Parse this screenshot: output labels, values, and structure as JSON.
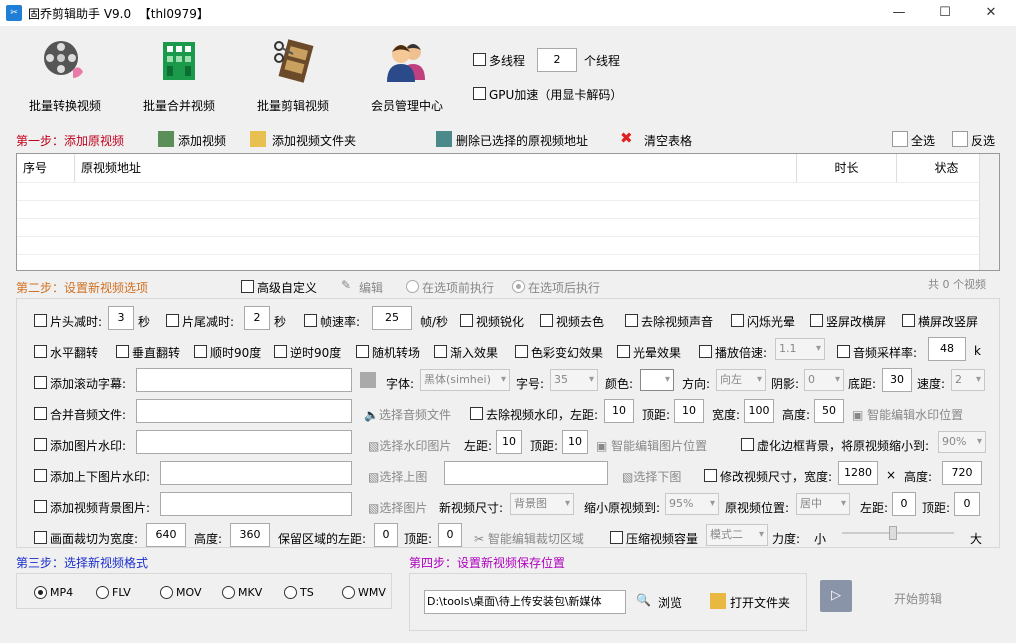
{
  "window": {
    "title": "固乔剪辑助手 V9.0  【thl0979】",
    "controls": {
      "minimize": "—",
      "maximize": "☐",
      "close": "✕"
    }
  },
  "toolbar": {
    "items": [
      {
        "label": "批量转换视频",
        "icon": "film-reel-icon"
      },
      {
        "label": "批量合并视频",
        "icon": "merge-film-icon"
      },
      {
        "label": "批量剪辑视频",
        "icon": "cut-film-icon"
      },
      {
        "label": "会员管理中心",
        "icon": "members-icon"
      }
    ],
    "multithread_label": "多线程",
    "thread_count": "2",
    "thread_unit": "个线程",
    "gpu_label": "GPU加速（用显卡解码）"
  },
  "step1": {
    "title": "第一步：添加原视频",
    "add_video": "添加视频",
    "add_folder": "添加视频文件夹",
    "remove_selected": "删除已选择的原视频地址",
    "clear_table": "清空表格",
    "select_all": "全选",
    "invert": "反选",
    "columns": [
      "序号",
      "原视频地址",
      "时长",
      "状态"
    ]
  },
  "step2": {
    "title": "第二步：设置新视频选项",
    "advanced": "高级自定义",
    "edit": "编辑",
    "before_option": "在选项前执行",
    "after_option": "在选项后执行",
    "count": "共 0 个视频",
    "row1": {
      "head_cut": "片头减时:",
      "head_val": "3",
      "sec1": "秒",
      "tail_cut": "片尾减时:",
      "tail_val": "2",
      "sec2": "秒",
      "framerate": "帧速率:",
      "framerate_val": "25",
      "fps": "帧/秒",
      "sharpen": "视频锐化",
      "decolor": "视频去色",
      "mute": "去除视频声音",
      "flash": "闪烁光晕",
      "v2h": "竖屏改横屏",
      "h2v": "横屏改竖屏"
    },
    "row2": {
      "hflip": "水平翻转",
      "vflip": "垂直翻转",
      "cw90": "顺时90度",
      "ccw90": "逆时90度",
      "random": "随机转场",
      "fadein": "渐入效果",
      "colorfx": "色彩变幻效果",
      "glow": "光晕效果",
      "speed": "播放倍速:",
      "speed_val": "1.1",
      "samplerate": "音频采样率:",
      "samplerate_val": "48",
      "k": "k"
    },
    "row3": {
      "subtitle": "添加滚动字幕:",
      "font": "字体:",
      "font_val": "黑体(simhei)",
      "size": "字号:",
      "size_val": "35",
      "color": "颜色:",
      "direction": "方向:",
      "direction_val": "向左",
      "shadow": "阴影:",
      "shadow_val": "0",
      "bottom": "底距:",
      "bottom_val": "30",
      "speed": "速度:",
      "speed_val": "2"
    },
    "row4": {
      "merge_audio": "合并音频文件:",
      "select_audio": "选择音频文件",
      "remove_watermark": "去除视频水印，左距:",
      "left_val": "10",
      "top": "顶距:",
      "top_val": "10",
      "width": "宽度:",
      "width_val": "100",
      "height": "高度:",
      "height_val": "50",
      "smart_wm": "智能编辑水印位置"
    },
    "row5": {
      "image_wm": "添加图片水印:",
      "select_wm": "选择水印图片",
      "left": "左距:",
      "left_val": "10",
      "top": "顶距:",
      "top_val": "10",
      "smart_img": "智能编辑图片位置",
      "blur_bg": "虚化边框背景，将原视频缩小到:",
      "blur_val": "90%"
    },
    "row6": {
      "topbottom": "添加上下图片水印:",
      "select_top": "选择上图",
      "select_bottom": "选择下图",
      "resize": "修改视频尺寸，宽度:",
      "width_val": "1280",
      "x": "×",
      "height": "高度:",
      "height_val": "720"
    },
    "row7": {
      "bg_image": "添加视频背景图片:",
      "select_img": "选择图片",
      "new_size": "新视频尺寸:",
      "new_size_val": "背景图",
      "shrink": "缩小原视频到:",
      "shrink_val": "95%",
      "position": "原视频位置:",
      "position_val": "居中",
      "left": "左距:",
      "left_val": "0",
      "top": "顶距:",
      "top_val": "0"
    },
    "row8": {
      "crop": "画面裁切为宽度:",
      "crop_w": "640",
      "height": "高度:",
      "crop_h": "360",
      "keep_left": "保留区域的左距:",
      "keep_left_val": "0",
      "top": "顶距:",
      "top_val": "0",
      "smart_crop": "智能编辑裁切区域",
      "compress": "压缩视频容量",
      "mode_val": "模式二",
      "strength": "力度:",
      "small": "小",
      "large": "大",
      "strength_level": 0.45
    }
  },
  "step3": {
    "title": "第三步：选择新视频格式",
    "formats": [
      "MP4",
      "FLV",
      "MOV",
      "MKV",
      "TS",
      "WMV"
    ],
    "selected": "MP4"
  },
  "step4": {
    "title": "第四步：设置新视频保存位置",
    "path": "D:\\tools\\桌面\\待上传安装包\\新媒体",
    "browse": "浏览",
    "open_folder": "打开文件夹",
    "start": "开始剪辑"
  },
  "colors": {
    "step1": "#c0001c",
    "step2": "#d07020",
    "step3": "#1a2ecc",
    "step4": "#b000c0"
  }
}
